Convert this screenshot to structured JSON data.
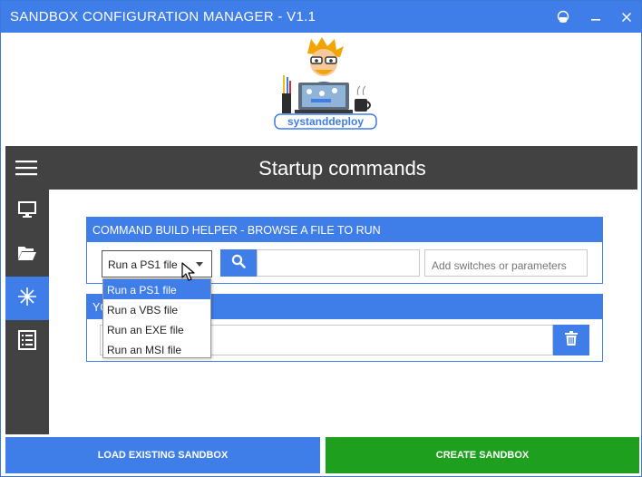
{
  "window": {
    "title": "SANDBOX CONFIGURATION MANAGER - V1.1",
    "controls": [
      "help-icon",
      "minimize-icon",
      "close-icon"
    ]
  },
  "logo": {
    "text": "systanddeploy"
  },
  "header": {
    "title": "Startup commands",
    "menu_icon": "hamburger-menu-icon"
  },
  "sidebar": {
    "items": [
      {
        "icon": "monitor-icon",
        "active": false
      },
      {
        "icon": "folder-open-icon",
        "active": false
      },
      {
        "icon": "asterisk-icon",
        "active": true
      },
      {
        "icon": "list-icon",
        "active": false
      }
    ]
  },
  "build_helper": {
    "title": "COMMAND BUILD HELPER - BROWSE A FILE TO RUN",
    "file_type_selected": "Run a PS1 file",
    "file_type_options": [
      "Run a PS1 file",
      "Run a VBS file",
      "Run an EXE file",
      "Run an MSI file"
    ],
    "file_path_value": "",
    "params_placeholder": "Add switches or parameters"
  },
  "command_section": {
    "title_visible_fragment": "YO",
    "command_value": ""
  },
  "footer": {
    "load_label": "LOAD EXISTING SANDBOX",
    "create_label": "CREATE SANDBOX"
  },
  "colors": {
    "accent": "#3f7de8",
    "dark": "#424242",
    "create": "#1ea01e"
  }
}
